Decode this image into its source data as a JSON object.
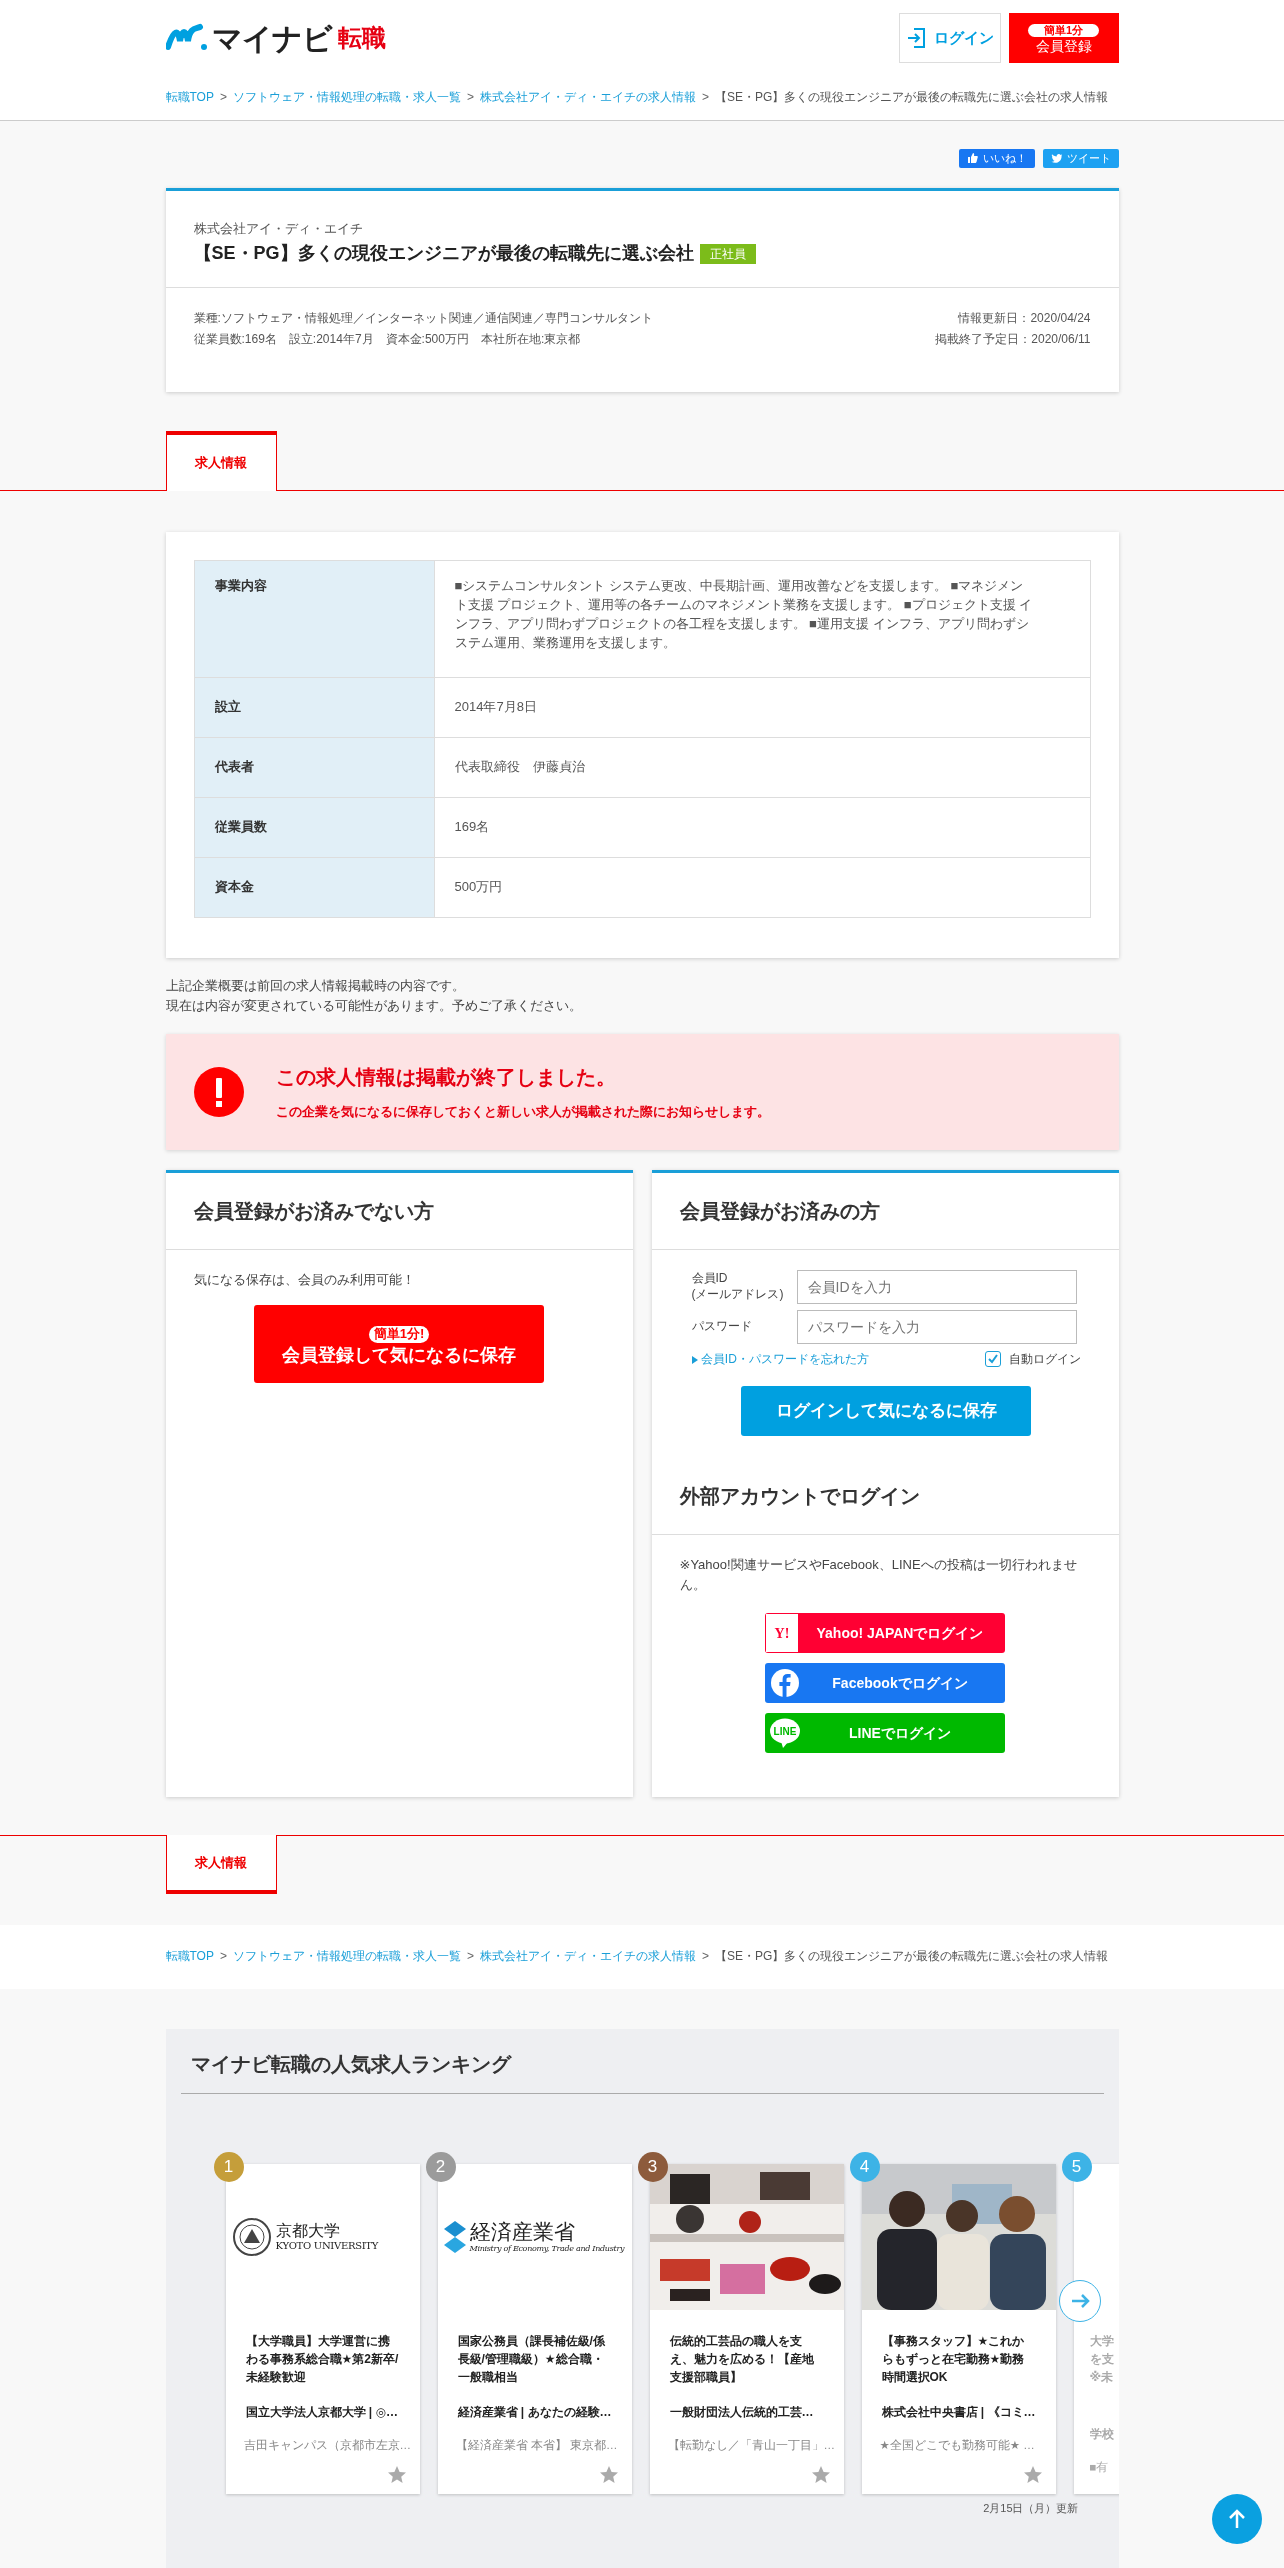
{
  "header": {
    "logo_text": "マイナビ",
    "logo_accent": "転職",
    "login_button": "ログイン",
    "register_badge": "簡単1分",
    "register_button": "会員登録"
  },
  "breadcrumb": [
    {
      "label": "転職TOP",
      "current": false
    },
    {
      "separator": ">",
      "label": "ソフトウェア・情報処理の転職・求人一覧",
      "current": false
    },
    {
      "separator": ">",
      "label": "株式会社アイ・ディ・エイチの求人情報",
      "current": false
    },
    {
      "separator": ">",
      "label": "【SE・PG】多くの現役エンジニアが最後の転職先に選ぶ会社の求人情報",
      "current": true
    }
  ],
  "social": [
    {
      "kind": "like",
      "label": "いいね！"
    },
    {
      "kind": "tweet",
      "label": "ツイート"
    }
  ],
  "company": {
    "name": "株式会社アイ・ディ・エイチ",
    "title": "【SE・PG】多くの現役エンジニアが最後の転職先に選ぶ会社",
    "employment_tag": "正社員",
    "details": [
      "業種:ソフトウェア・情報処理／インターネット関連／通信関連／専門コンサルタント",
      "従業員数:169名　設立:2014年7月　資本金:500万円　本社所在地:東京都"
    ],
    "dates": [
      "情報更新日：2020/04/24",
      "掲載終了予定日：2020/06/11"
    ]
  },
  "tabs": [
    {
      "label": "求人情報",
      "selected": true
    }
  ],
  "company_table": [
    {
      "label": "事業内容",
      "value": "■システムコンサルタント システム更改、中長期計画、運用改善などを支援します。 ■マネジメント支援 プロジェクト、運用等の各チームのマネジメント業務を支援します。 ■プロジェクト支援 インフラ、アプリ問わずプロジェクトの各工程を支援します。 ■運用支援 インフラ、アプリ問わずシステム運用、業務運用を支援します。"
    },
    {
      "label": "設立",
      "value": "2014年7月8日"
    },
    {
      "label": "代表者",
      "value": "代表取締役　伊藤貞治"
    },
    {
      "label": "従業員数",
      "value": "169名"
    },
    {
      "label": "資本金",
      "value": "500万円"
    }
  ],
  "note": [
    "上記企業概要は前回の求人情報掲載時の内容です。",
    "現在は内容が変更されている可能性があります。予めご了承ください。"
  ],
  "alert": {
    "title": "この求人情報は掲載が終了しました。",
    "message": "この企業を気になるに保存しておくと新しい求人が掲載された際にお知らせします。"
  },
  "guest_panel": {
    "title": "会員登録がお済みでない方",
    "text": "気になる保存は、会員のみ利用可能！",
    "badge": "簡単1分!",
    "button": "会員登録して気になるに保存"
  },
  "member_panel": {
    "title": "会員登録がお済みの方",
    "fields": [
      {
        "label": "会員ID",
        "sublabel": "(メールアドレス)",
        "placeholder": "会員IDを入力"
      },
      {
        "label": "パスワード",
        "placeholder": "パスワードを入力"
      }
    ],
    "forgot_link": "会員ID・パスワードを忘れた方",
    "auto_login": {
      "label": "自動ログイン",
      "checked": true
    },
    "button": "ログインして気になるに保存"
  },
  "external_login": {
    "title": "外部アカウントでログイン",
    "note": "※Yahoo!関連サービスやFacebook、LINEへの投稿は一切行われません。",
    "buttons": [
      {
        "kind": "yahoo",
        "icon_text": "Y!",
        "label": "Yahoo! JAPANでログイン"
      },
      {
        "kind": "facebook",
        "label": "Facebookでログイン"
      },
      {
        "kind": "line",
        "icon_text": "LINE",
        "label": "LINEでログイン"
      }
    ]
  },
  "bottom_tabs": [
    {
      "label": "求人情報",
      "selected": true
    }
  ],
  "bottom_breadcrumb": [
    {
      "label": "転職TOP",
      "current": false
    },
    {
      "separator": ">",
      "label": "ソフトウェア・情報処理の転職・求人一覧",
      "current": false
    },
    {
      "separator": ">",
      "label": "株式会社アイ・ディ・エイチの求人情報",
      "current": false
    },
    {
      "separator": ">",
      "label": "【SE・PG】多くの現役エンジニアが最後の転職先に選ぶ会社の求人情報",
      "current": true
    }
  ],
  "ranking": {
    "title": "マイナビ転職の人気求人ランキング",
    "cards": [
      {
        "rank": "1",
        "color": "#c59e3a",
        "kind": "crest",
        "logo_text": "京都大学",
        "logo_sub": "KYOTO UNIVERSITY",
        "title": "【大学職員】大学運営に携わる事務系総合職★第2新卒/未経験歓迎",
        "company": "国立大学法人京都大学 | ◎…",
        "location": "吉田キャンパス（京都市左京…"
      },
      {
        "rank": "2",
        "color": "#9b9b9b",
        "kind": "chevron",
        "logo_text": "経済産業省",
        "logo_sub": "Ministry of Economy, Trade and Industry",
        "title": "国家公務員（課長補佐級/係長級/管理職級）★総合職・一般職相当",
        "company": "経済産業省 | あなたの経験…",
        "location": "【経済産業省 本省】 東京都…"
      },
      {
        "rank": "3",
        "color": "#8d5b3c",
        "kind": "crafts",
        "title": "伝統的工芸品の職人を支え、魅力を広める！【産地支援部職員】",
        "company": "一般財団法人伝統的工芸…",
        "location": "【転勤なし／「青山一丁目」…"
      },
      {
        "rank": "4",
        "color": "#3db3e6",
        "kind": "people",
        "title": "【事務スタッフ】★これからもずっと在宅勤務★勤務時間選択OK",
        "company": "株式会社中央書店 | 《コミ…",
        "location": "★全国どこでも勤務可能★ …"
      },
      {
        "rank": "5",
        "color": "#3db3e6",
        "kind": "partial",
        "title": "大学を支※未",
        "company": "学校",
        "location": "■有"
      }
    ],
    "updated": "2月15日（月）更新"
  }
}
